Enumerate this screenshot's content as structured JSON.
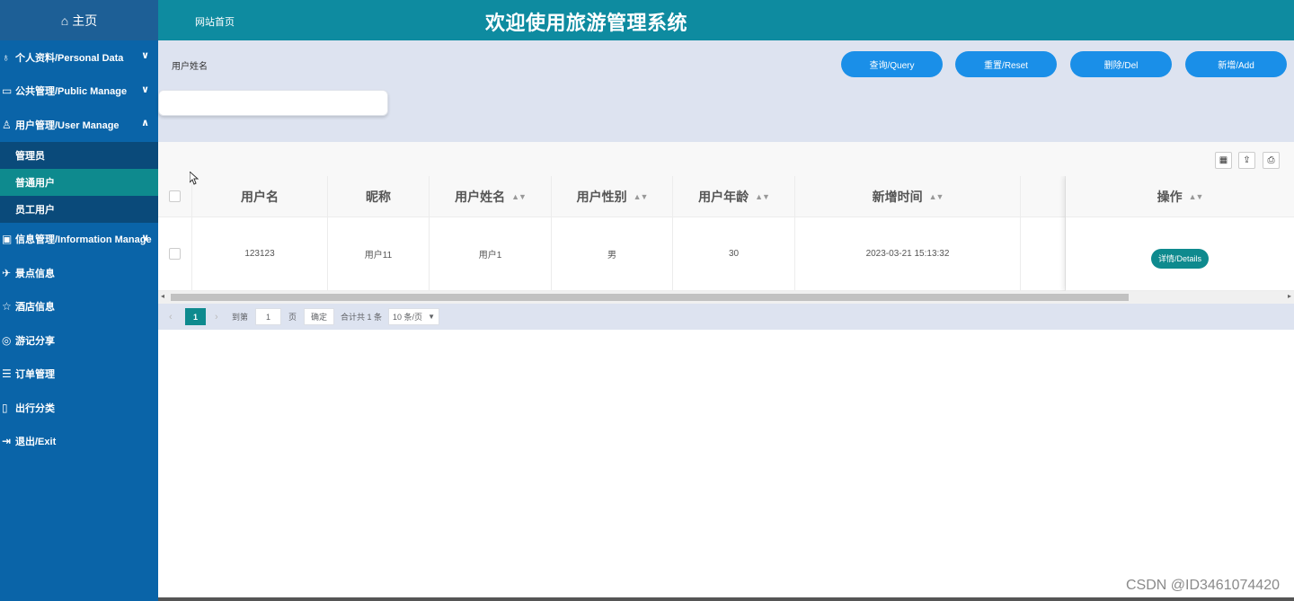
{
  "sidebar": {
    "home_label": "主页",
    "items": [
      {
        "label": "个人资料/Personal Data",
        "icon": "user-list-icon",
        "chevron": "⌄"
      },
      {
        "label": "公共管理/Public Manage",
        "icon": "monitor-icon",
        "chevron": "⌄"
      },
      {
        "label": "用户管理/User Manage",
        "icon": "user-icon",
        "chevron": "⌃"
      }
    ],
    "subitems": [
      {
        "label": "管理员",
        "active": false
      },
      {
        "label": "普通用户",
        "active": true
      },
      {
        "label": "员工用户",
        "active": false
      }
    ],
    "items_after": [
      {
        "label": "信息管理/Information Manage",
        "icon": "info-icon",
        "chevron": "⌄"
      },
      {
        "label": "景点信息",
        "icon": "map-pin-icon"
      },
      {
        "label": "酒店信息",
        "icon": "hotel-icon"
      },
      {
        "label": "游记分享",
        "icon": "share-icon"
      },
      {
        "label": "订单管理",
        "icon": "order-icon"
      },
      {
        "label": "出行分类",
        "icon": "category-icon"
      },
      {
        "label": "退出/Exit",
        "icon": "exit-icon"
      }
    ]
  },
  "topbar": {
    "site_home": "网站首页",
    "title": "欢迎使用旅游管理系统"
  },
  "search": {
    "label": "用户姓名",
    "value": "",
    "buttons": {
      "query": "查询/Query",
      "reset": "重置/Reset",
      "delete": "删除/Del",
      "add": "新增/Add"
    }
  },
  "table": {
    "headers": [
      "用户名",
      "昵称",
      "用户姓名",
      "用户性别",
      "用户年龄",
      "新增时间",
      "",
      "操作"
    ],
    "sort_glyph": "▲▼",
    "rows": [
      {
        "username": "123123",
        "nickname": "用户11",
        "name": "用户1",
        "gender": "男",
        "age": "30",
        "created": "2023-03-21 15:13:32",
        "action": "详情/Details"
      }
    ]
  },
  "pager": {
    "current": "1",
    "goto_label": "到第",
    "goto_value": "1",
    "page_unit": "页",
    "confirm": "确定",
    "total": "合计共 1 条",
    "page_size": "10 条/页"
  },
  "watermark": "CSDN @ID3461074420",
  "colors": {
    "sidebar": "#0a64a8",
    "topbar": "#0e8ba0",
    "accent": "#0e8a8e",
    "button": "#1a8fe8",
    "search_bg": "#dde3f0"
  }
}
